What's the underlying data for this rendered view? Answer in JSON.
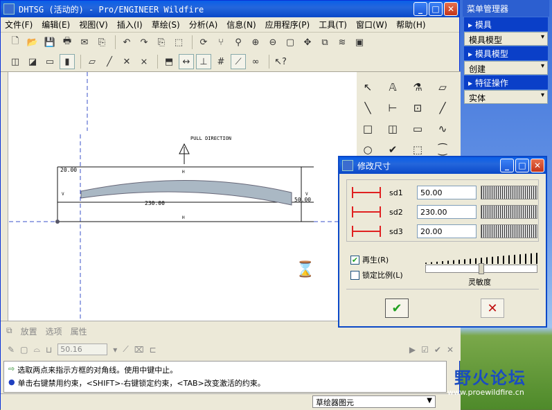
{
  "window": {
    "title": "DHTSG (活动的) - Pro/ENGINEER Wildfire"
  },
  "menu": [
    "文件(F)",
    "编辑(E)",
    "视图(V)",
    "插入(I)",
    "草绘(S)",
    "分析(A)",
    "信息(N)",
    "应用程序(P)",
    "工具(T)",
    "窗口(W)",
    "帮助(H)"
  ],
  "drawing": {
    "pull_direction": "PULL DIRECTION",
    "dim_left": "20.00",
    "dim_bottom": "230.00",
    "dim_right": "50.00",
    "label_h": "H",
    "label_v": "V"
  },
  "panel": {
    "tabs": [
      "放置",
      "选项",
      "属性"
    ],
    "value": "50.16"
  },
  "status": {
    "line1": "选取两点来指示方框的对角线。使用中键中止。",
    "line2": "单击右键禁用约束，<SHIFT>-右键锁定约束，<TAB>改变激活的约束。",
    "filter": "草绘器图元"
  },
  "dialog": {
    "title": "修改尺寸",
    "dims": [
      {
        "name": "sd1",
        "value": "50.00"
      },
      {
        "name": "sd2",
        "value": "230.00"
      },
      {
        "name": "sd3",
        "value": "20.00"
      }
    ],
    "regen_label": "再生(R)",
    "lock_label": "锁定比例(L)",
    "sensitivity_label": "灵敏度"
  },
  "menu_manager": {
    "title": "菜单管理器",
    "sections": [
      {
        "header": "模具",
        "item": "模具模型"
      },
      {
        "header": "模具模型",
        "item": "创建"
      },
      {
        "header": "特征操作",
        "item": "实体"
      }
    ]
  },
  "watermark": {
    "name": "野火论坛",
    "url": "www.proewildfire.cn"
  }
}
